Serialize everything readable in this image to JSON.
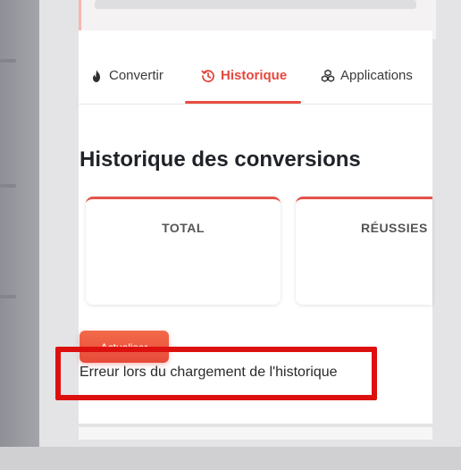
{
  "tabs": [
    {
      "label": "Convertir",
      "icon": "flame-icon",
      "active": false
    },
    {
      "label": "Historique",
      "icon": "history-icon",
      "active": true
    },
    {
      "label": "Applications",
      "icon": "cubes-icon",
      "active": false
    }
  ],
  "history": {
    "title": "Historique des conversions",
    "stats": [
      {
        "label": "TOTAL"
      },
      {
        "label": "RÉUSSIES"
      }
    ],
    "refresh_label": "Actualiser",
    "error_message": "Erreur lors du chargement de l'historique"
  },
  "colors": {
    "accent": "#e5483d",
    "highlight": "#dd1010"
  }
}
